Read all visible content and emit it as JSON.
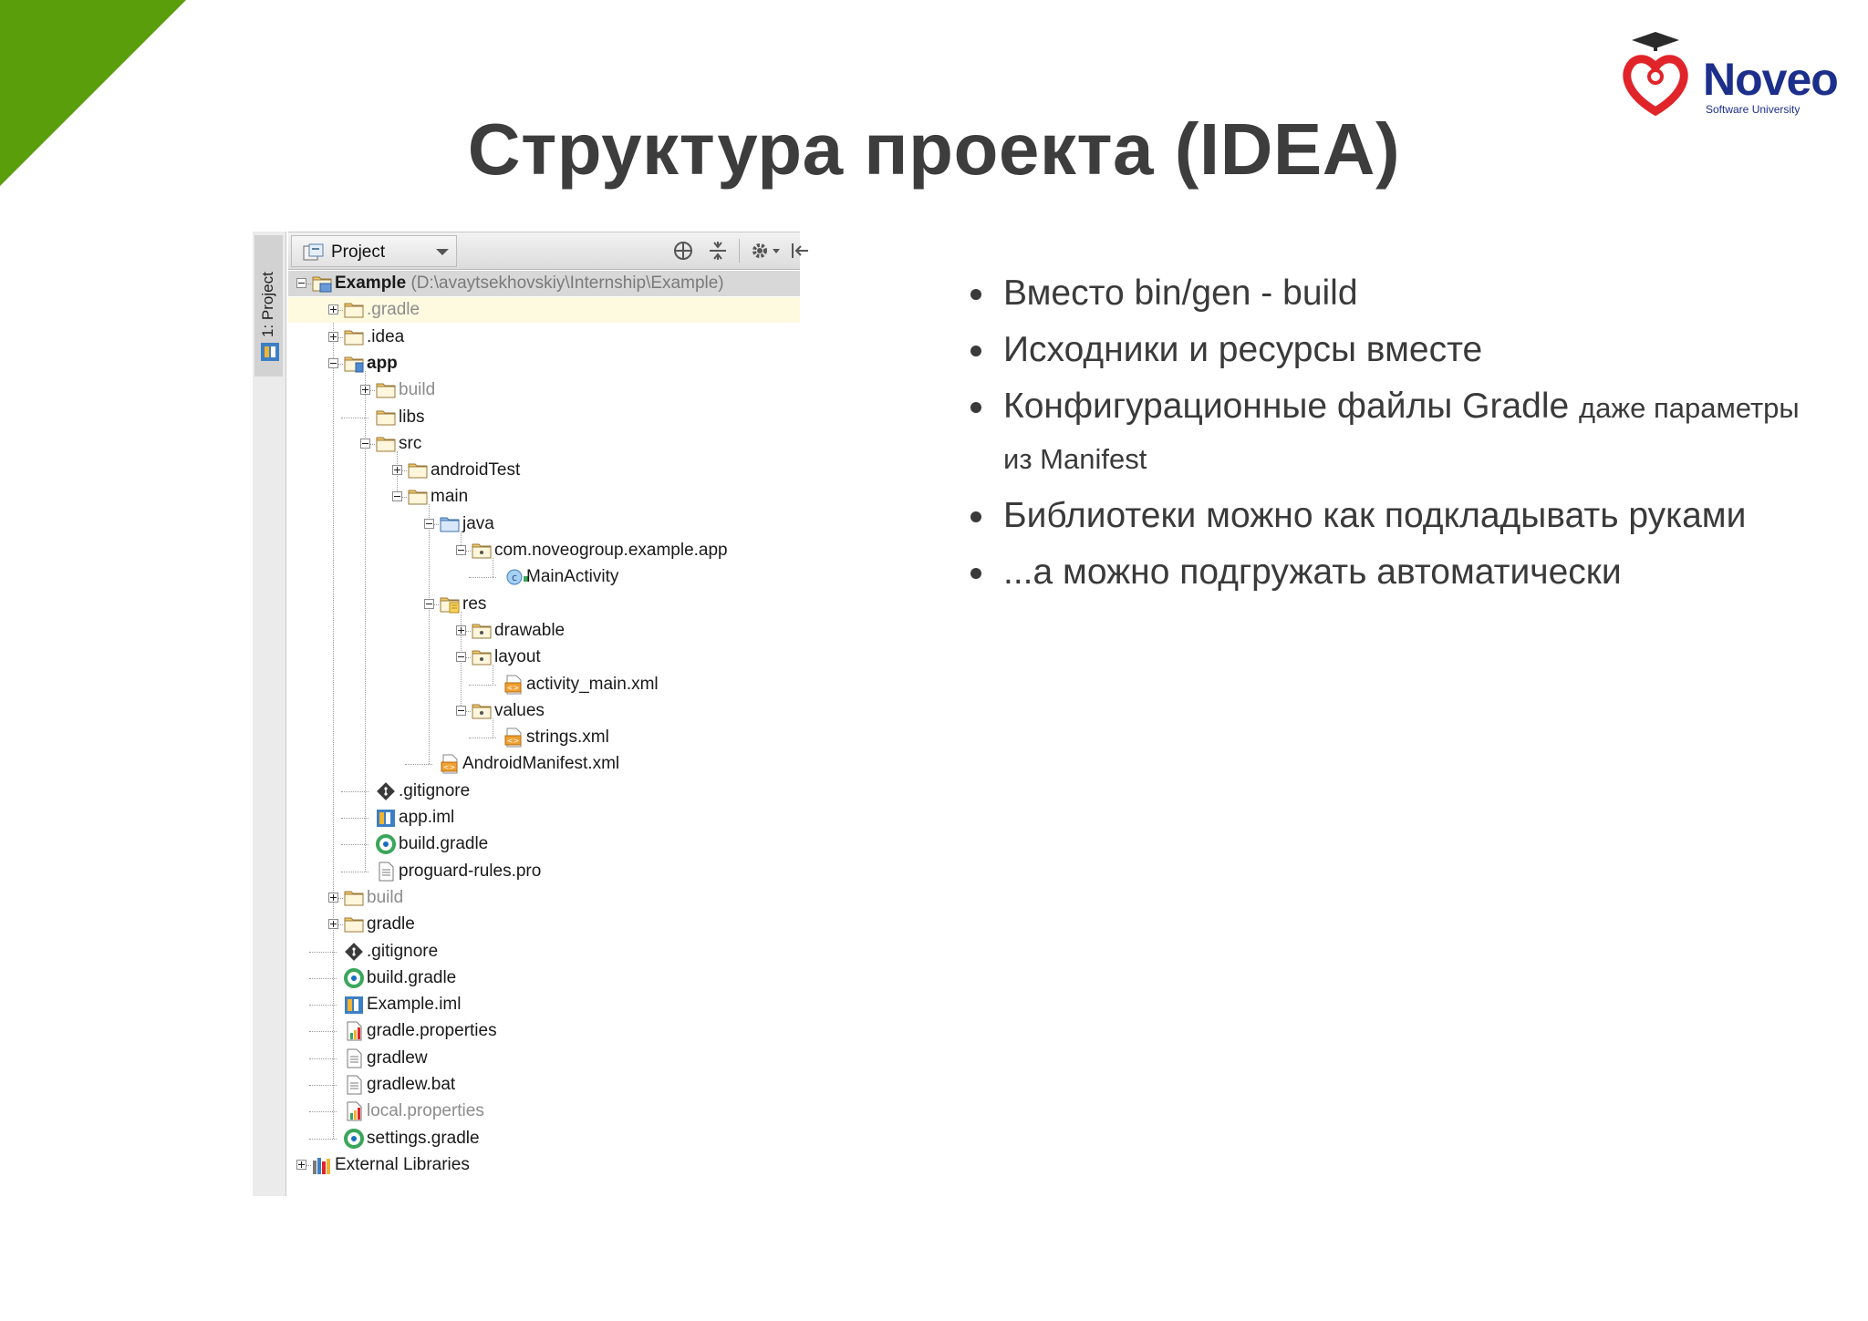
{
  "slide": {
    "title": "Структура проекта (IDEA)",
    "logo": {
      "name": "Noveo",
      "subtitle": "Software University"
    }
  },
  "ide": {
    "side_tab": "1: Project",
    "view_selector": "Project",
    "toolbar_icons": [
      "scroll-from-source-icon",
      "collapse-all-icon",
      "settings-icon",
      "hide-icon"
    ],
    "tree": [
      {
        "label": "Example",
        "path": "(D:\\avaytsekhovskiy\\Internship\\Example)",
        "icon": "project-folder-icon"
      },
      {
        "label": ".gradle",
        "icon": "folder-icon"
      },
      {
        "label": ".idea",
        "icon": "folder-icon"
      },
      {
        "label": "app",
        "icon": "module-folder-icon"
      },
      {
        "label": "build",
        "icon": "folder-icon"
      },
      {
        "label": "libs",
        "icon": "folder-icon"
      },
      {
        "label": "src",
        "icon": "folder-icon"
      },
      {
        "label": "androidTest",
        "icon": "folder-icon"
      },
      {
        "label": "main",
        "icon": "folder-icon"
      },
      {
        "label": "java",
        "icon": "source-folder-icon"
      },
      {
        "label": "com.noveogroup.example.app",
        "icon": "package-icon"
      },
      {
        "label": "MainActivity",
        "icon": "class-icon"
      },
      {
        "label": "res",
        "icon": "resource-folder-icon"
      },
      {
        "label": "drawable",
        "icon": "package-icon"
      },
      {
        "label": "layout",
        "icon": "package-icon"
      },
      {
        "label": "activity_main.xml",
        "icon": "xml-file-icon"
      },
      {
        "label": "values",
        "icon": "package-icon"
      },
      {
        "label": "strings.xml",
        "icon": "xml-file-icon"
      },
      {
        "label": "AndroidManifest.xml",
        "icon": "xml-file-icon"
      },
      {
        "label": ".gitignore",
        "icon": "git-icon"
      },
      {
        "label": "app.iml",
        "icon": "iml-icon"
      },
      {
        "label": "build.gradle",
        "icon": "gradle-icon"
      },
      {
        "label": "proguard-rules.pro",
        "icon": "text-file-icon"
      },
      {
        "label": "build",
        "icon": "folder-icon"
      },
      {
        "label": "gradle",
        "icon": "folder-icon"
      },
      {
        "label": ".gitignore",
        "icon": "git-icon"
      },
      {
        "label": "build.gradle",
        "icon": "gradle-icon"
      },
      {
        "label": "Example.iml",
        "icon": "iml-icon"
      },
      {
        "label": "gradle.properties",
        "icon": "properties-icon"
      },
      {
        "label": "gradlew",
        "icon": "text-file-icon"
      },
      {
        "label": "gradlew.bat",
        "icon": "text-file-icon"
      },
      {
        "label": "local.properties",
        "icon": "properties-icon"
      },
      {
        "label": "settings.gradle",
        "icon": "gradle-icon"
      },
      {
        "label": "External Libraries",
        "icon": "libraries-icon"
      }
    ]
  },
  "bullets": [
    {
      "text": "Вместо bin/gen - build"
    },
    {
      "text": "Исходники и ресурсы вместе"
    },
    {
      "text": "Конфигурационные файлы Gradle",
      "note": "даже параметры из Manifest"
    },
    {
      "text": "Библиотеки можно как подкладывать руками"
    },
    {
      "text": "...а можно подгружать автоматически"
    }
  ],
  "colors": {
    "accent_green": "#5a9e0c",
    "logo_blue": "#1c2f8a",
    "logo_red": "#e0242a"
  }
}
